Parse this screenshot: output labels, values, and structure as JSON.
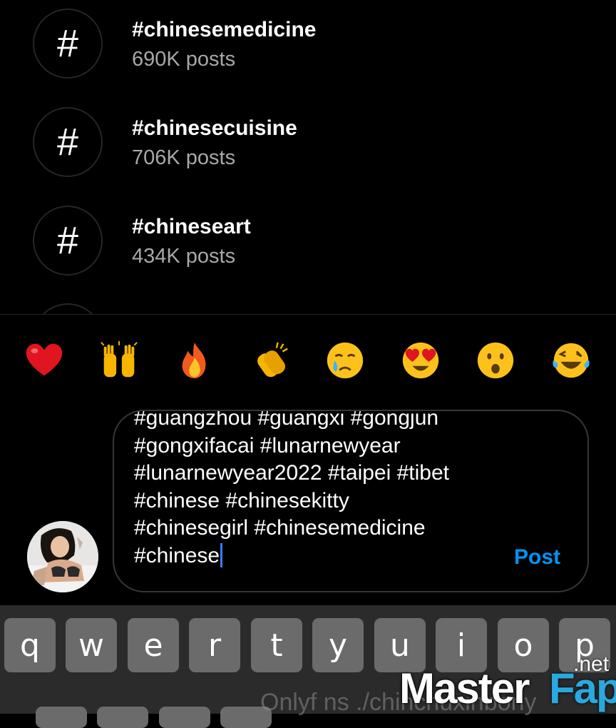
{
  "suggestions": [
    {
      "symbol": "#",
      "tag": "#chinesemedicine",
      "count": "690K posts"
    },
    {
      "symbol": "#",
      "tag": "#chinesecuisine",
      "count": "706K posts"
    },
    {
      "symbol": "#",
      "tag": "#chineseart",
      "count": "434K posts"
    }
  ],
  "emojis": [
    {
      "name": "red-heart",
      "char": "❤️"
    },
    {
      "name": "raising-hands",
      "char": "🙌"
    },
    {
      "name": "fire",
      "char": "🔥"
    },
    {
      "name": "clapping-hands",
      "char": "👏"
    },
    {
      "name": "crying-face",
      "char": "😢"
    },
    {
      "name": "heart-eyes",
      "char": "😍"
    },
    {
      "name": "surprised-face",
      "char": "😮"
    },
    {
      "name": "tears-of-joy",
      "char": "😂"
    }
  ],
  "comment": {
    "text": "#guangzhou #guangxi #gongjun\n#gongxifacai #lunarnewyear\n#lunarnewyear2022 #taipei #tibet\n#chinese #chinesekitty\n#chinesegirl #chinesemedicine\n#chinese",
    "post_label": "Post"
  },
  "keyboard": {
    "row1": [
      "q",
      "w",
      "e",
      "r",
      "t",
      "y",
      "u",
      "i",
      "o",
      "p"
    ]
  },
  "watermark": {
    "caption": "Onlyf ns ./chinchuxinboriy",
    "logo_master": "Master",
    "logo_fap": "Fap",
    "logo_net": ".net"
  },
  "colors": {
    "background": "#000000",
    "secondary_text": "#a8a8a8",
    "post_blue": "#0095f6",
    "caret_blue": "#3a7cff",
    "key_gray": "#6b6b6b",
    "logo_blue": "#29a9e0"
  }
}
